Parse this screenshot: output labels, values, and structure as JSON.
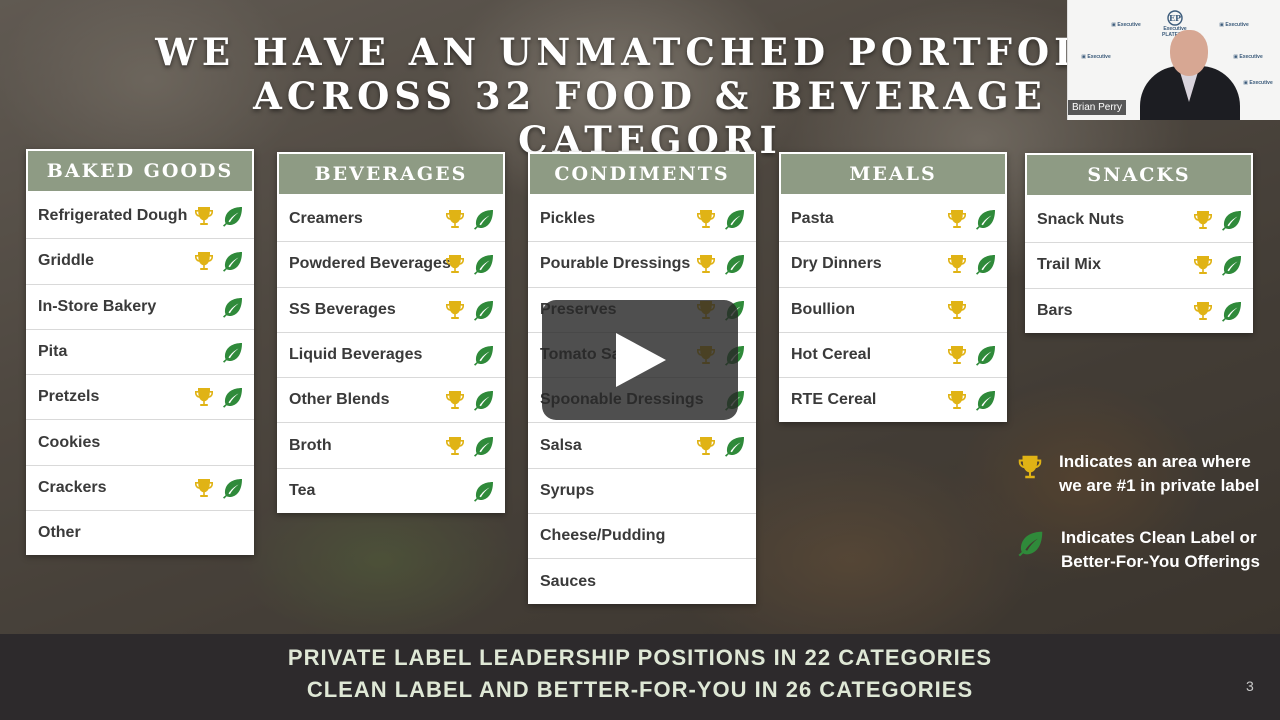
{
  "title": {
    "line1": "WE HAVE AN UNMATCHED PORTFOLIO",
    "line2": "ACROSS 32 FOOD & BEVERAGE CATEGORI"
  },
  "categories": [
    {
      "header": "BAKED GOODS",
      "rows": [
        {
          "label": "Refrigerated Dough",
          "trophy": true,
          "leaf": true
        },
        {
          "label": "Griddle",
          "trophy": true,
          "leaf": true
        },
        {
          "label": "In-Store Bakery",
          "trophy": false,
          "leaf": true
        },
        {
          "label": "Pita",
          "trophy": false,
          "leaf": true
        },
        {
          "label": "Pretzels",
          "trophy": true,
          "leaf": true
        },
        {
          "label": "Cookies",
          "trophy": false,
          "leaf": false
        },
        {
          "label": "Crackers",
          "trophy": true,
          "leaf": true
        },
        {
          "label": "Other",
          "trophy": false,
          "leaf": false
        }
      ]
    },
    {
      "header": "BEVERAGES",
      "rows": [
        {
          "label": "Creamers",
          "trophy": true,
          "leaf": true
        },
        {
          "label": "Powdered Beverages",
          "trophy": true,
          "leaf": true
        },
        {
          "label": "SS Beverages",
          "trophy": true,
          "leaf": true
        },
        {
          "label": "Liquid Beverages",
          "trophy": false,
          "leaf": true
        },
        {
          "label": "Other Blends",
          "trophy": true,
          "leaf": true
        },
        {
          "label": "Broth",
          "trophy": true,
          "leaf": true
        },
        {
          "label": "Tea",
          "trophy": false,
          "leaf": true
        }
      ]
    },
    {
      "header": "CONDIMENTS",
      "rows": [
        {
          "label": "Pickles",
          "trophy": true,
          "leaf": true
        },
        {
          "label": "Pourable Dressings",
          "trophy": true,
          "leaf": true
        },
        {
          "label": "Preserves",
          "trophy": true,
          "leaf": true
        },
        {
          "label": "Tomato Sa",
          "trophy": true,
          "leaf": true
        },
        {
          "label": "Spoonable Dressings",
          "trophy": false,
          "leaf": true
        },
        {
          "label": "Salsa",
          "trophy": true,
          "leaf": true
        },
        {
          "label": "Syrups",
          "trophy": false,
          "leaf": false
        },
        {
          "label": "Cheese/Pudding",
          "trophy": false,
          "leaf": false
        },
        {
          "label": "Sauces",
          "trophy": false,
          "leaf": false
        }
      ]
    },
    {
      "header": "MEALS",
      "rows": [
        {
          "label": "Pasta",
          "trophy": true,
          "leaf": true
        },
        {
          "label": "Dry Dinners",
          "trophy": true,
          "leaf": true
        },
        {
          "label": "Boullion",
          "trophy": true,
          "leaf": false
        },
        {
          "label": "Hot Cereal",
          "trophy": true,
          "leaf": true
        },
        {
          "label": "RTE Cereal",
          "trophy": true,
          "leaf": true
        }
      ]
    },
    {
      "header": "SNACKS",
      "rows": [
        {
          "label": "Snack Nuts",
          "trophy": true,
          "leaf": true
        },
        {
          "label": "Trail Mix",
          "trophy": true,
          "leaf": true
        },
        {
          "label": "Bars",
          "trophy": true,
          "leaf": true
        }
      ]
    }
  ],
  "legend": {
    "trophy_text": "Indicates an area where we are #1 in private label",
    "leaf_text": "Indicates Clean Label or Better-For-You Offerings"
  },
  "footer": {
    "line1": "PRIVATE LABEL LEADERSHIP POSITIONS IN 22 CATEGORIES",
    "line2": "CLEAN LABEL AND BETTER-FOR-YOU IN 26 CATEGORIES"
  },
  "page_number": "3",
  "webcam": {
    "name": "Brian Perry",
    "logo_text": "Executive PLATFORMS"
  },
  "icons": {
    "trophy": "trophy-icon",
    "leaf": "leaf-icon",
    "play": "play-icon"
  },
  "colors": {
    "header_bg": "#8e9b84",
    "trophy": "#e0b315",
    "leaf": "#2f8a3a",
    "footer_bg": "#2d2a2c",
    "footer_text": "#dfe8d6"
  }
}
